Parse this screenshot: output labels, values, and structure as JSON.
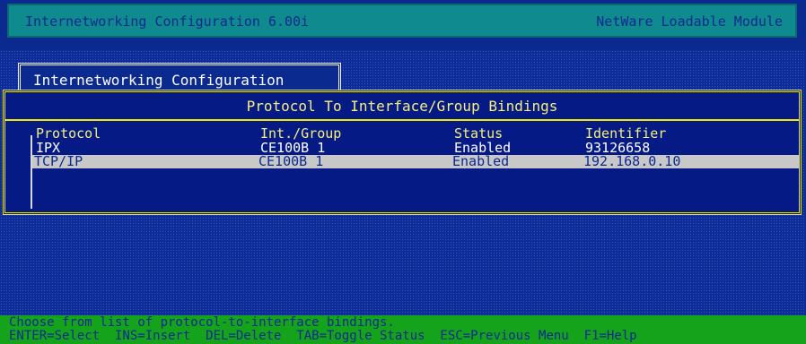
{
  "titlebar": {
    "left_text": "Internetworking Configuration  6.00i",
    "right_text": "NetWare Loadable Module"
  },
  "tab": {
    "label": "Internetworking Configuration"
  },
  "panel": {
    "title": "Protocol To Interface/Group Bindings",
    "columns": [
      "Protocol",
      "Int./Group",
      "Status",
      "Identifier"
    ],
    "rows": [
      {
        "protocol": "IPX",
        "group": "CE100B_1",
        "status": "Enabled",
        "identifier": "93126658"
      },
      {
        "protocol": "TCP/IP",
        "group": "CE100B_1",
        "status": "Enabled",
        "identifier": "192.168.0.10"
      }
    ],
    "selected_row": 1
  },
  "statusbar": {
    "hint": "Choose from list of protocol-to-interface bindings.",
    "keys": "ENTER=Select  INS=Insert  DEL=Delete  TAB=Toggle Status  ESC=Previous Menu  F1=Help"
  },
  "colors": {
    "background": "#0b2a90",
    "titlebar": "#0f8a8f",
    "panel_border": "#f1e800",
    "selection": "#c8c8c8",
    "statusbar": "#16a31c"
  }
}
